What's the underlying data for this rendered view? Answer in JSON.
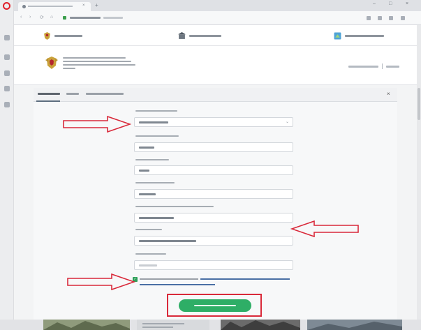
{
  "browser": {
    "tab_close": "×",
    "tab_new": "+",
    "nav": {
      "back": "‹",
      "forward": "›",
      "reload": "⟳",
      "home": "⌂"
    },
    "window": {
      "minimize": "–",
      "maximize": "□",
      "close": "×"
    }
  },
  "site": {
    "card": {
      "close_label": "×"
    },
    "form": {
      "select_chevron": "⌄",
      "consent_check": "✓"
    }
  },
  "colors": {
    "accent_green": "#2eae66",
    "annotation_red": "#d9293a",
    "brand_red": "#e0212b"
  },
  "icons": [
    "opera-logo-icon",
    "coat-of-arms-icon",
    "arrow-annotation-icon"
  ]
}
